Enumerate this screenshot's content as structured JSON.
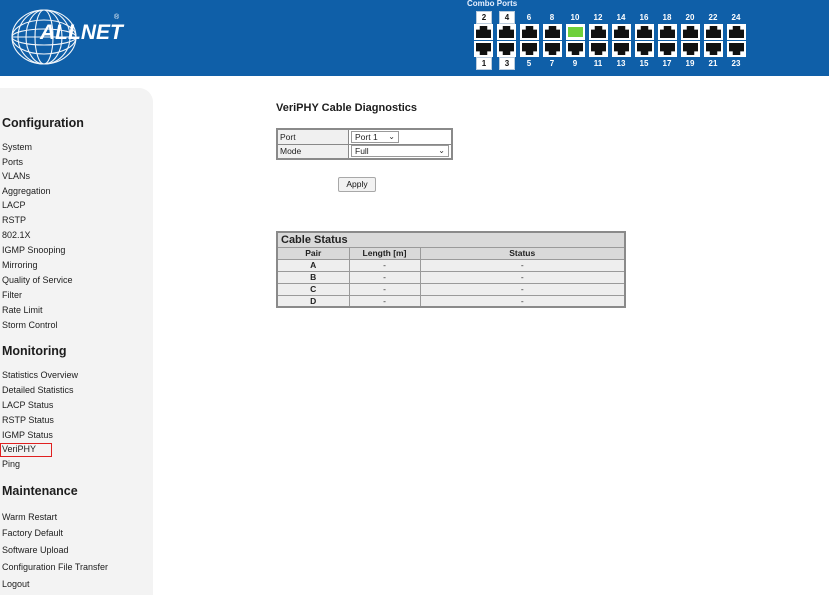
{
  "header": {
    "logo_text": "ALLNET",
    "logo_reg": "®",
    "combo_label": "Combo Ports",
    "top_port_numbers": [
      "2",
      "4",
      "6",
      "8",
      "10",
      "12",
      "14",
      "16",
      "18",
      "20",
      "22",
      "24"
    ],
    "bottom_port_numbers": [
      "1",
      "3",
      "5",
      "7",
      "9",
      "11",
      "13",
      "15",
      "17",
      "19",
      "21",
      "23"
    ],
    "active_port": "10"
  },
  "sidebar": {
    "configuration": {
      "title": "Configuration",
      "items": [
        "System",
        "Ports",
        "VLANs",
        "Aggregation",
        "LACP",
        "RSTP",
        "802.1X",
        "IGMP Snooping",
        "Mirroring",
        "Quality of Service",
        "Filter",
        "Rate Limit",
        "Storm Control"
      ]
    },
    "monitoring": {
      "title": "Monitoring",
      "items": [
        "Statistics Overview",
        "Detailed Statistics",
        "LACP Status",
        "RSTP Status",
        "IGMP Status",
        "VeriPHY",
        "Ping"
      ]
    },
    "maintenance": {
      "title": "Maintenance",
      "items": [
        "Warm Restart",
        "Factory Default",
        "Software Upload",
        "Configuration File Transfer",
        "Logout"
      ]
    },
    "selected_item": "VeriPHY"
  },
  "main": {
    "title": "VeriPHY Cable Diagnostics",
    "form": {
      "port_label": "Port",
      "port_value": "Port 1",
      "mode_label": "Mode",
      "mode_value": "Full"
    },
    "apply_label": "Apply",
    "cable_status": {
      "caption": "Cable Status",
      "columns": [
        "Pair",
        "Length [m]",
        "Status"
      ],
      "rows": [
        [
          "A",
          "-",
          "-"
        ],
        [
          "B",
          "-",
          "-"
        ],
        [
          "C",
          "-",
          "-"
        ],
        [
          "D",
          "-",
          "-"
        ]
      ]
    }
  },
  "colors": {
    "header_bg": "#0f5fa8",
    "sidebar_bg": "#f3f3f3",
    "selection_border": "#e02020",
    "active_port": "#6fd03a"
  }
}
